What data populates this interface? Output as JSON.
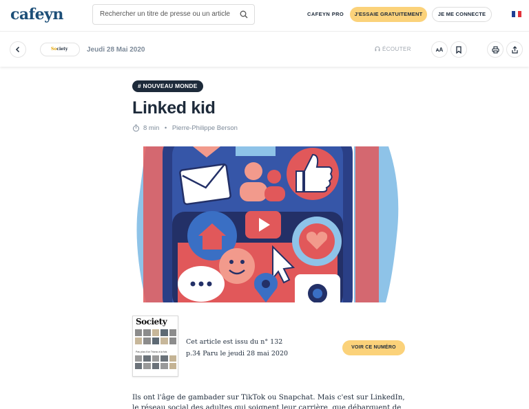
{
  "header": {
    "logo": "cafeyn",
    "search_placeholder": "Rechercher un titre de presse ou un article",
    "pro_label": "CAFEYN PRO",
    "trial_label": "J'ESSAIE GRATUITEMENT",
    "login_label": "JE ME CONNECTE",
    "language_flag": "fr-flag-icon"
  },
  "toolbar": {
    "back_icon": "chevron-left-icon",
    "magazine_name_prefix": "So",
    "magazine_name_rest": "ciety",
    "issue_date": "Jeudi 28 Mai 2020",
    "listen_label": "ÉCOUTER",
    "font_size_label": "ᴀA",
    "bookmark_icon": "bookmark-icon",
    "print_icon": "print-icon",
    "share_icon": "share-icon"
  },
  "article": {
    "tag": "# NOUVEAU MONDE",
    "title": "Linked kid",
    "reading_time": "8 min",
    "separator": "•",
    "author": "Pierre-Philippe Berson",
    "illustration_icons": [
      "envelope-icon",
      "people-icon",
      "thumbs-up-icon",
      "home-icon",
      "play-icon",
      "heart-icon",
      "smiley-icon",
      "cursor-icon",
      "chat-icon",
      "location-icon",
      "camera-icon"
    ]
  },
  "source": {
    "cover_title": "Society",
    "cover_tagline": "Pas plus d'un Tricrac à la fois",
    "line1": "Cet article est issu du n° 132",
    "line2": "p.34 Paru le jeudi 28 mai 2020",
    "button_label": "VOIR CE NUMÉRO"
  },
  "body": {
    "text": "Ils ont l'âge de gambader sur TikTok ou Snapchat. Mais c'est sur LinkedIn, le réseau social des adultes qui soignent leur carrière, que débarquent de plus en plus de"
  },
  "colors": {
    "brand": "#1d4f78",
    "accent_yellow": "#fbd27a",
    "dark": "#1d2a3a",
    "muted": "#7d8a99"
  }
}
